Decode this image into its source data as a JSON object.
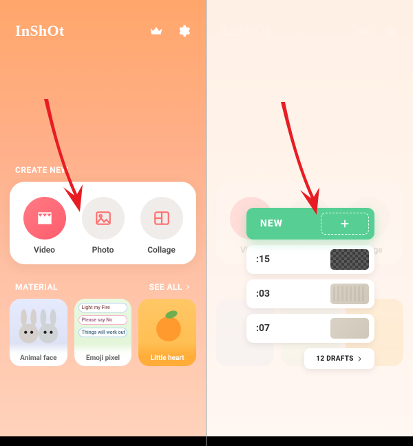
{
  "app_name": "InShOt",
  "icons": {
    "crown": "crown-icon",
    "gear": "gear-icon"
  },
  "create_section_label": "CREATE NEW",
  "create_items": [
    {
      "label": "Video",
      "icon": "clapperboard-icon"
    },
    {
      "label": "Photo",
      "icon": "image-icon"
    },
    {
      "label": "Collage",
      "icon": "collage-icon"
    }
  ],
  "material_section_label": "MATERIAL",
  "see_all_label": "SEE ALL",
  "material_items": [
    {
      "label": "Animal face",
      "tags": []
    },
    {
      "label": "Emoji pixel",
      "tags": [
        "Light my Fire",
        "Please say No",
        "Things will work out"
      ]
    },
    {
      "label": "Little heart",
      "tags": []
    }
  ],
  "popup": {
    "new_label": "NEW",
    "drafts": [
      {
        "time": ":15"
      },
      {
        "time": ":03"
      },
      {
        "time": ":07"
      }
    ],
    "drafts_count_label": "12 DRAFTS"
  },
  "colors": {
    "accent_green": "#57cf94",
    "arrow_red": "#e81c23",
    "pink": "#ff5c6c"
  }
}
